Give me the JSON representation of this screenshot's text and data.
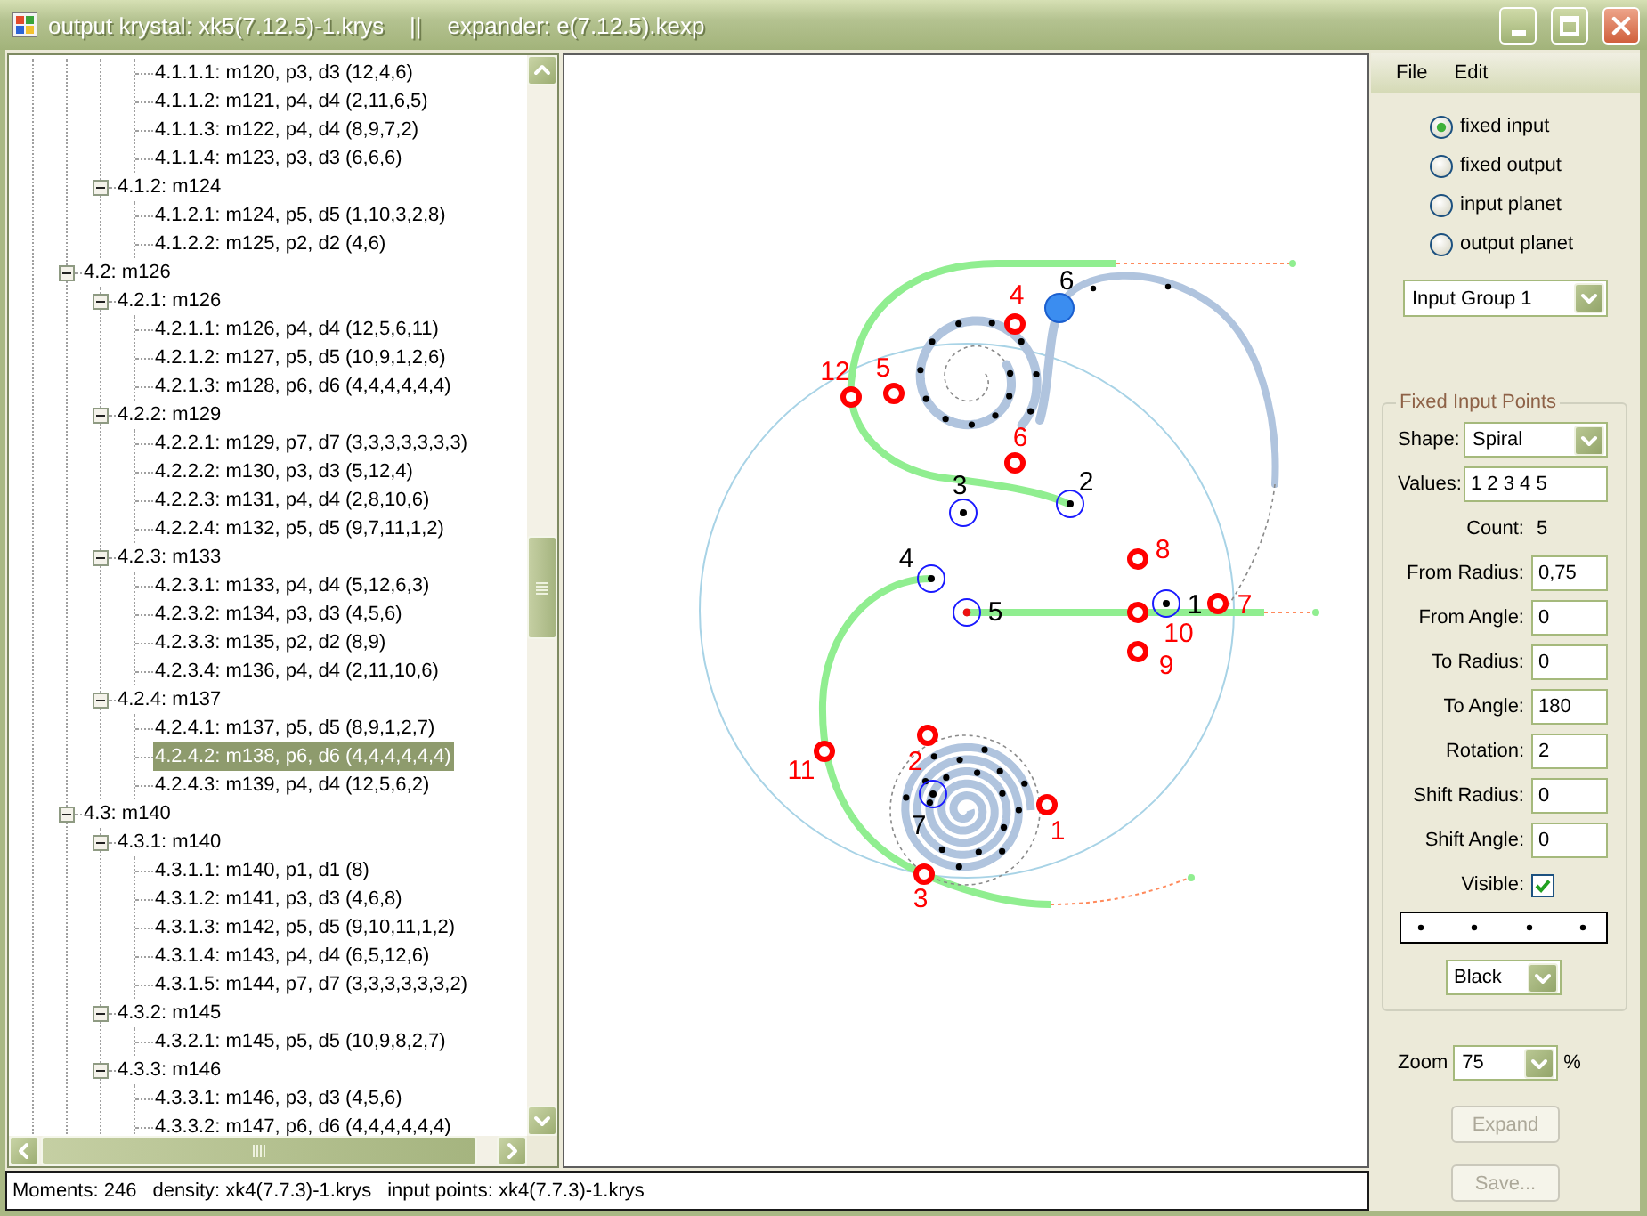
{
  "window": {
    "title": "output krystal: xk5(7.12.5)-1.krys    ||    expander: e(7.12.5).kexp"
  },
  "tree": {
    "items": [
      {
        "children": [
          {
            "children": [
              {
                "children": [
                  {
                    "label": "4.1.1.1: m120, p3, d3 (12,4,6)",
                    "selected": false
                  },
                  {
                    "label": "4.1.1.2: m121, p4, d4 (2,11,6,5)",
                    "selected": false
                  },
                  {
                    "label": "4.1.1.3: m122, p4, d4 (8,9,7,2)",
                    "selected": false
                  },
                  {
                    "label": "4.1.1.4: m123, p3, d3 (6,6,6)",
                    "selected": false
                  }
                ]
              },
              {
                "label": "4.1.2: m124",
                "expanded": true,
                "selected": false,
                "children": [
                  {
                    "label": "4.1.2.1: m124, p5, d5 (1,10,3,2,8)",
                    "selected": false
                  },
                  {
                    "label": "4.1.2.2: m125, p2, d2 (4,6)",
                    "selected": false
                  }
                ]
              }
            ]
          },
          {
            "label": "4.2: m126",
            "expanded": true,
            "selected": false,
            "children": [
              {
                "label": "4.2.1: m126",
                "expanded": true,
                "selected": false,
                "children": [
                  {
                    "label": "4.2.1.1: m126, p4, d4 (12,5,6,11)",
                    "selected": false
                  },
                  {
                    "label": "4.2.1.2: m127, p5, d5 (10,9,1,2,6)",
                    "selected": false
                  },
                  {
                    "label": "4.2.1.3: m128, p6, d6 (4,4,4,4,4,4)",
                    "selected": false
                  }
                ]
              },
              {
                "label": "4.2.2: m129",
                "expanded": true,
                "selected": false,
                "children": [
                  {
                    "label": "4.2.2.1: m129, p7, d7 (3,3,3,3,3,3,3)",
                    "selected": false
                  },
                  {
                    "label": "4.2.2.2: m130, p3, d3 (5,12,4)",
                    "selected": false
                  },
                  {
                    "label": "4.2.2.3: m131, p4, d4 (2,8,10,6)",
                    "selected": false
                  },
                  {
                    "label": "4.2.2.4: m132, p5, d5 (9,7,11,1,2)",
                    "selected": false
                  }
                ]
              },
              {
                "label": "4.2.3: m133",
                "expanded": true,
                "selected": false,
                "children": [
                  {
                    "label": "4.2.3.1: m133, p4, d4 (5,12,6,3)",
                    "selected": false
                  },
                  {
                    "label": "4.2.3.2: m134, p3, d3 (4,5,6)",
                    "selected": false
                  },
                  {
                    "label": "4.2.3.3: m135, p2, d2 (8,9)",
                    "selected": false
                  },
                  {
                    "label": "4.2.3.4: m136, p4, d4 (2,11,10,6)",
                    "selected": false
                  }
                ]
              },
              {
                "label": "4.2.4: m137",
                "expanded": true,
                "selected": false,
                "children": [
                  {
                    "label": "4.2.4.1: m137, p5, d5 (8,9,1,2,7)",
                    "selected": false
                  },
                  {
                    "label": "4.2.4.2: m138, p6, d6 (4,4,4,4,4,4)",
                    "selected": true
                  },
                  {
                    "label": "4.2.4.3: m139, p4, d4 (12,5,6,2)",
                    "selected": false
                  }
                ]
              }
            ]
          },
          {
            "label": "4.3: m140",
            "expanded": true,
            "selected": false,
            "children": [
              {
                "label": "4.3.1: m140",
                "expanded": true,
                "selected": false,
                "children": [
                  {
                    "label": "4.3.1.1: m140, p1, d1 (8)",
                    "selected": false
                  },
                  {
                    "label": "4.3.1.2: m141, p3, d3 (4,6,8)",
                    "selected": false
                  },
                  {
                    "label": "4.3.1.3: m142, p5, d5 (9,10,11,1,2)",
                    "selected": false
                  },
                  {
                    "label": "4.3.1.4: m143, p4, d4 (6,5,12,6)",
                    "selected": false
                  },
                  {
                    "label": "4.3.1.5: m144, p7, d7 (3,3,3,3,3,3,2)",
                    "selected": false
                  }
                ]
              },
              {
                "label": "4.3.2: m145",
                "expanded": true,
                "selected": false,
                "children": [
                  {
                    "label": "4.3.2.1: m145, p5, d5 (10,9,8,2,7)",
                    "selected": false
                  }
                ]
              },
              {
                "label": "4.3.3: m146",
                "expanded": true,
                "selected": false,
                "children": [
                  {
                    "label": "4.3.3.1: m146, p3, d3 (4,5,6)",
                    "selected": false
                  },
                  {
                    "label": "4.3.3.2: m147, p6, d6 (4,4,4,4,4,4)",
                    "selected": false
                  }
                ]
              }
            ]
          }
        ]
      }
    ]
  },
  "canvas": {
    "output_points": [
      {
        "label": "4"
      },
      {
        "label": "5"
      },
      {
        "label": "12"
      },
      {
        "label": "6"
      },
      {
        "label": "8"
      },
      {
        "label": "7"
      },
      {
        "label": "10"
      },
      {
        "label": "9"
      },
      {
        "label": "2"
      },
      {
        "label": "11"
      },
      {
        "label": "1"
      },
      {
        "label": "3"
      }
    ],
    "input_points": [
      {
        "label": "6",
        "selected": true
      },
      {
        "label": "2",
        "selected": false
      },
      {
        "label": "3",
        "selected": false
      },
      {
        "label": "4",
        "selected": false
      },
      {
        "label": "1",
        "selected": false
      },
      {
        "label": "5",
        "selected": false
      },
      {
        "label": "7",
        "selected": false
      }
    ]
  },
  "status_bar": [
    "Moments: 246",
    "density: xk4(7.7.3)-1.krys",
    "input points: xk4(7.7.3)-1.krys"
  ],
  "menu": [
    "File",
    "Edit"
  ],
  "modes": [
    {
      "label": "fixed input",
      "selected": true
    },
    {
      "label": "fixed output",
      "selected": false
    },
    {
      "label": "input planet",
      "selected": false
    },
    {
      "label": "output planet",
      "selected": false
    }
  ],
  "group_select": {
    "value": "Input Group 1"
  },
  "fixed_input_points": {
    "title": "Fixed Input Points",
    "shape": {
      "label": "Shape:",
      "value": "Spiral"
    },
    "values": {
      "label": "Values:",
      "value": "1 2 3 4 5"
    },
    "count": {
      "label": "Count:",
      "value": "5"
    },
    "params": [
      {
        "label": "From Radius:",
        "value": "0,75"
      },
      {
        "label": "From Angle:",
        "value": "0"
      },
      {
        "label": "To Radius:",
        "value": "0"
      },
      {
        "label": "To Angle:",
        "value": "180"
      },
      {
        "label": "Rotation:",
        "value": "2"
      },
      {
        "label": "Shift Radius:",
        "value": "0"
      },
      {
        "label": "Shift Angle:",
        "value": "0"
      }
    ],
    "visible": {
      "label": "Visible:",
      "checked": true
    },
    "color": {
      "value": "Black"
    }
  },
  "zoom": {
    "label": "Zoom",
    "value": "75",
    "unit": "%"
  },
  "buttons": [
    {
      "label": "Expand",
      "disabled": true
    },
    {
      "label": "Save...",
      "disabled": true
    }
  ]
}
